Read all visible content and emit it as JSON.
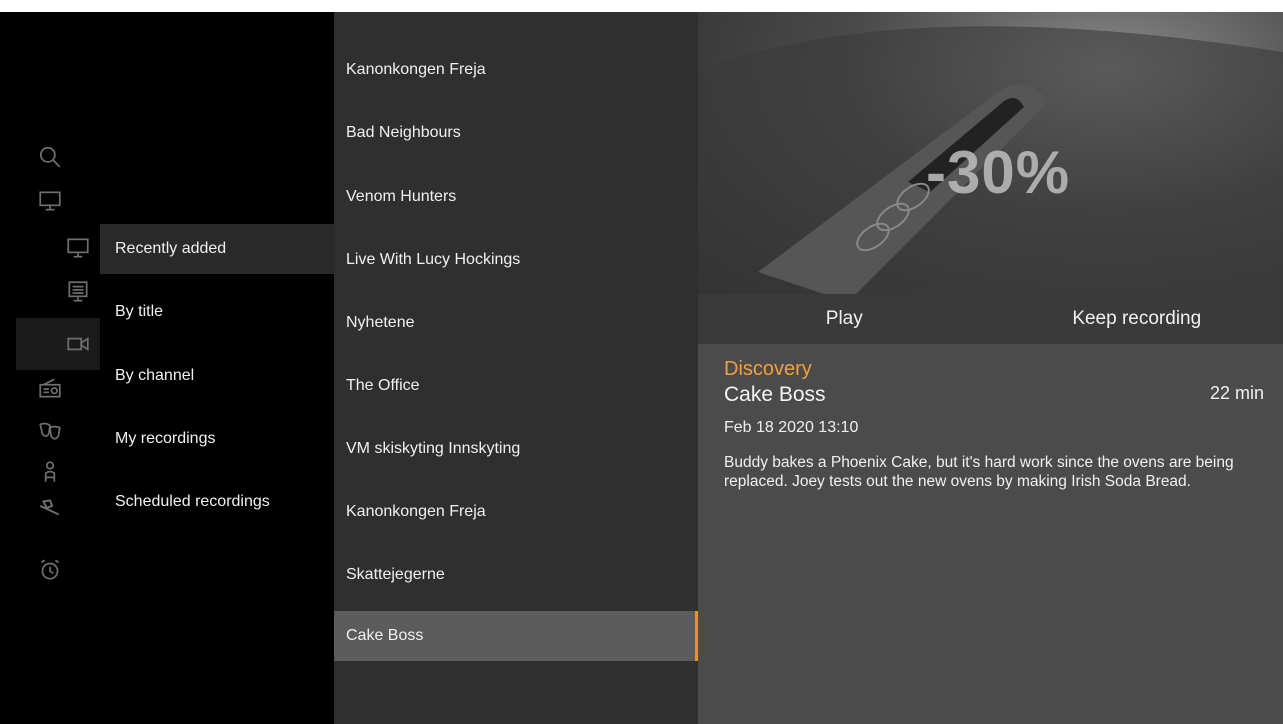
{
  "rail": {
    "icons": [
      "search-icon",
      "tv-icon",
      "tv-live-icon",
      "tv-guide-icon",
      "camera-icon",
      "radio-icon",
      "theater-masks-icon",
      "person-icon",
      "tools-icon",
      "alarm-clock-icon"
    ]
  },
  "categories": [
    {
      "label": "Recently added",
      "selected": true
    },
    {
      "label": "By title"
    },
    {
      "label": "By channel"
    },
    {
      "label": "My recordings"
    },
    {
      "label": "Scheduled recordings"
    }
  ],
  "programs": [
    "Kanonkongen Freja",
    "Bad Neighbours",
    "Venom Hunters",
    "Live With Lucy Hockings",
    "Nyhetene",
    "The Office",
    "VM skiskyting Innskyting",
    "Kanonkongen Freja",
    "Skattejegerne",
    "Cake Boss"
  ],
  "selected_program_index": 9,
  "hero": {
    "overlay_text": "-30%"
  },
  "actions": {
    "play": "Play",
    "keep": "Keep recording"
  },
  "details": {
    "channel": "Discovery",
    "title": "Cake Boss",
    "duration": "22 min",
    "datetime": "Feb 18 2020  13:10",
    "description": "Buddy bakes a Phoenix Cake, but it's hard work since the ovens are being replaced. Joey tests out the new ovens by making Irish Soda Bread."
  },
  "colors": {
    "accent": "#e8902a",
    "channel": "#f0a040"
  }
}
